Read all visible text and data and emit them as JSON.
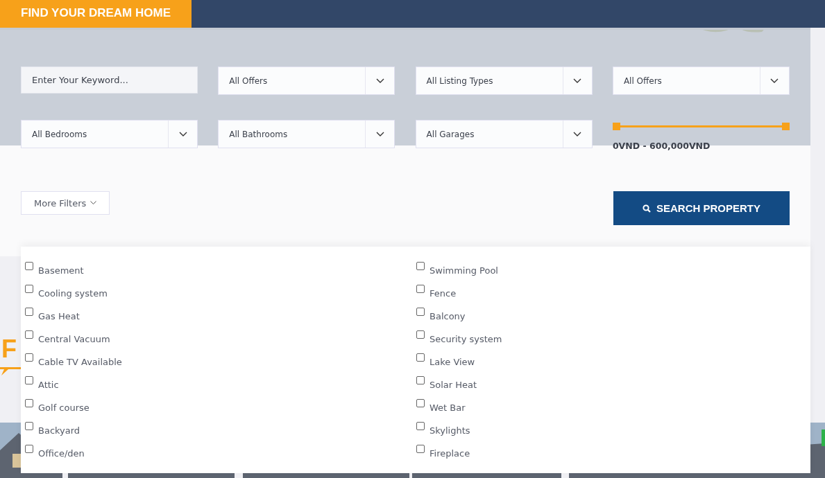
{
  "header_tab": "FIND YOUR DREAM HOME",
  "keyword": {
    "placeholder": "Enter Your Keyword..."
  },
  "selects_row1": [
    "All Offers",
    "All Listing Types",
    "All Offers"
  ],
  "selects_row2": [
    "All Bedrooms",
    "All Bathrooms",
    "All Garages"
  ],
  "price_range": {
    "reading": "0VND - 600,000VND",
    "level": 1
  },
  "more_filters": "More Filters",
  "search_button": "SEARCH PROPERTY",
  "section_heading_fragment": "F",
  "amenities": [
    {
      "label": "Basement",
      "checked": false
    },
    {
      "label": "Cooling system",
      "checked": false
    },
    {
      "label": "Gas Heat",
      "checked": false
    },
    {
      "label": "Central Vacuum",
      "checked": false
    },
    {
      "label": "Cable TV Available",
      "checked": false
    },
    {
      "label": "Attic",
      "checked": false
    },
    {
      "label": "Golf course",
      "checked": false
    },
    {
      "label": "Backyard",
      "checked": false
    },
    {
      "label": "Office/den",
      "checked": false
    },
    {
      "label": "Swimming Pool",
      "checked": false
    },
    {
      "label": "Fence",
      "checked": false
    },
    {
      "label": "Balcony",
      "checked": false
    },
    {
      "label": "Security system",
      "checked": false
    },
    {
      "label": "Lake View",
      "checked": false
    },
    {
      "label": "Solar Heat",
      "checked": false
    },
    {
      "label": "Wet Bar",
      "checked": false
    },
    {
      "label": "Skylights",
      "checked": false
    },
    {
      "label": "Fireplace",
      "checked": false
    }
  ]
}
